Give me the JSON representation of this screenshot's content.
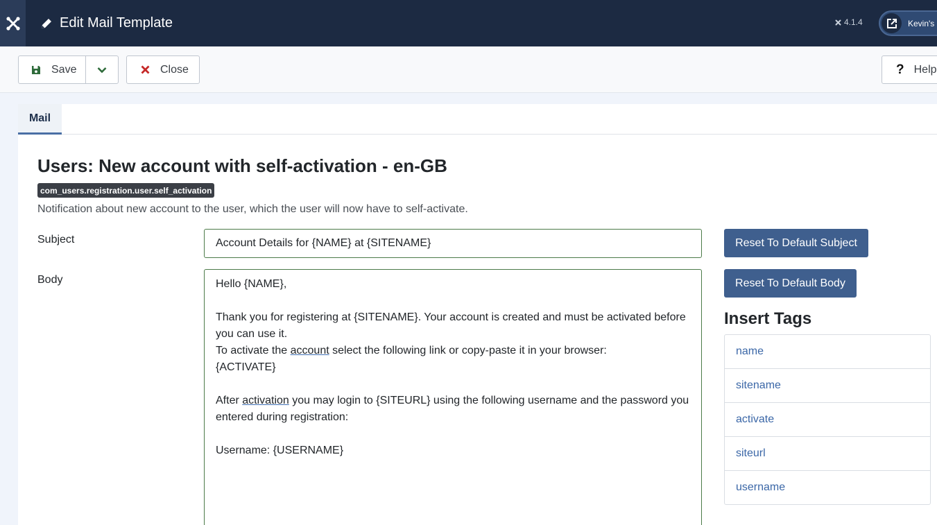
{
  "header": {
    "title": "Edit Mail Template",
    "version": "4.1.4",
    "user_label": "Kevin's E",
    "icons": [
      "joomla-logo-icon",
      "pencil-icon",
      "external-link-icon"
    ]
  },
  "toolbar": {
    "save_label": "Save",
    "close_label": "Close",
    "help_label": "Help",
    "help_glyph": "?"
  },
  "tabs": [
    {
      "label": "Mail",
      "active": true
    }
  ],
  "template": {
    "title": "Users: New account with self-activation - en-GB",
    "key": "com_users.registration.user.self_activation",
    "description": "Notification about new account to the user, which the user will now have to self-activate."
  },
  "form": {
    "subject_label": "Subject",
    "subject_value": "Account Details for {NAME} at {SITENAME}",
    "body_label": "Body",
    "body_lines": {
      "l1": "Hello {NAME},",
      "l2": "",
      "l3": "Thank you for registering at {SITENAME}. Your account is created and must be activated before you can use it.",
      "l4a": "To activate the ",
      "l4b": "account",
      "l4c": " select the following link or copy-paste it in your browser:",
      "l5": "{ACTIVATE}",
      "l6": "",
      "l7a": "After ",
      "l7b": "activation",
      "l7c": " you may login to {SITEURL} using the following username and the password you entered during registration:",
      "l8": "",
      "l9": "Username: {USERNAME}"
    }
  },
  "sidebar": {
    "reset_subject_label": "Reset To Default Subject",
    "reset_body_label": "Reset To Default Body",
    "insert_tags_title": "Insert Tags",
    "tags": [
      "name",
      "sitename",
      "activate",
      "siteurl",
      "username"
    ]
  },
  "colors": {
    "header_bg": "#1c2a42",
    "primary_button": "#3f5f8e",
    "link": "#3b67a7",
    "input_border_valid": "#4b7a48"
  }
}
